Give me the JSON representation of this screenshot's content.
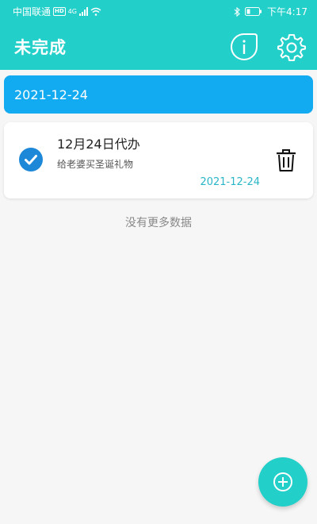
{
  "status_bar": {
    "carrier": "中国联通",
    "hd": "HD",
    "network": "4G",
    "time": "下午4:17",
    "icons": [
      "signal-icon",
      "wifi-icon",
      "bluetooth-icon",
      "battery-icon"
    ]
  },
  "header": {
    "title": "未完成",
    "icons": [
      "info-icon",
      "settings-icon"
    ]
  },
  "date_group": {
    "label": "2021-12-24"
  },
  "tasks": [
    {
      "title": "12月24日代办",
      "description": "给老婆买圣诞礼物",
      "date": "2021-12-24",
      "checked": true
    }
  ],
  "list_footer": "没有更多数据",
  "fab_icon": "add-icon",
  "colors": {
    "header_bg": "#23cfc9",
    "date_bar_bg": "#12aaf0",
    "check_bg": "#1e88d8",
    "date_text": "#29b6c6"
  }
}
